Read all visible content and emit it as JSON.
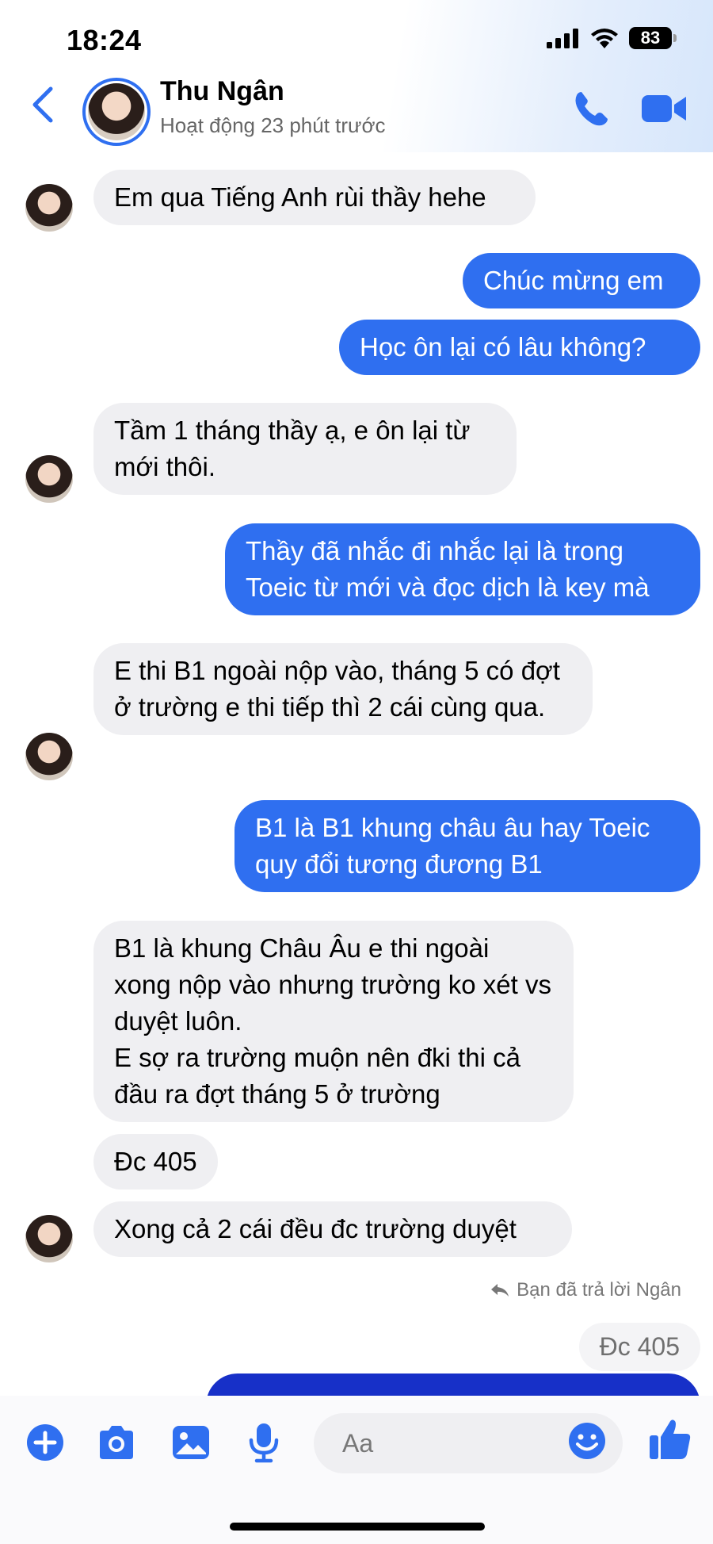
{
  "status_bar": {
    "time": "18:24",
    "battery": "83"
  },
  "header": {
    "contact_name": "Thu Ngân",
    "contact_status": "Hoạt động 23 phút trước",
    "icons": [
      "back-chevron-icon",
      "phone-icon",
      "video-camera-icon"
    ]
  },
  "messages": [
    {
      "from": "them",
      "text": "Em qua Tiếng Anh rùi thầy hehe"
    },
    {
      "from": "me",
      "text": "Chúc mừng em"
    },
    {
      "from": "me",
      "text": "Học ôn lại có lâu không?"
    },
    {
      "from": "them",
      "text": "Tầm 1 tháng thầy ạ, e ôn lại từ mới thôi."
    },
    {
      "from": "me",
      "text": "Thầy đã nhắc đi nhắc lại là trong Toeic từ mới và đọc dịch là key mà"
    },
    {
      "from": "them",
      "text": "E thi B1 ngoài nộp vào, tháng 5 có đợt ở trường e thi tiếp thì 2 cái cùng qua."
    },
    {
      "from": "me",
      "text": "B1 là B1 khung châu âu hay Toeic quy đổi tương đương B1"
    },
    {
      "from": "them",
      "text": "B1 là khung Châu Âu e thi ngoài xong nộp vào nhưng trường ko xét vs duyệt luôn.\nE sợ ra trường muộn nên đki thi cả đầu ra đợt tháng 5 ở trường"
    },
    {
      "from": "them",
      "text": "Đc 405"
    },
    {
      "from": "them",
      "text": "Xong cả 2 cái đều đc trường duyệt"
    }
  ],
  "reply": {
    "note": "Bạn đã trả lời Ngân",
    "quoted": "Đc 405"
  },
  "composer": {
    "placeholder": "Aa",
    "icons": [
      "plus-icon",
      "camera-icon",
      "image-icon",
      "microphone-icon",
      "emoji-icon",
      "thumbs-up-icon"
    ]
  },
  "colors": {
    "accent": "#2f6ff0",
    "incoming_bubble": "#efeff2",
    "outgoing_bubble": "#2f6ff0"
  }
}
